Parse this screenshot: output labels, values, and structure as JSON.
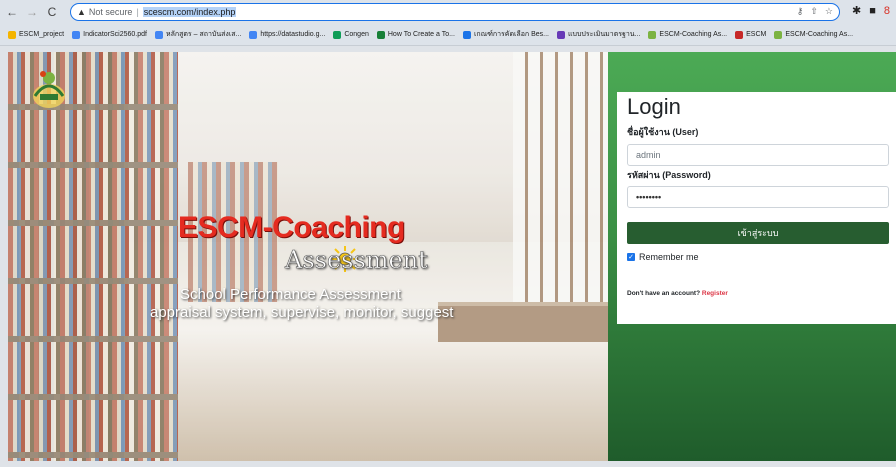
{
  "browser": {
    "security_label": "Not secure",
    "url": "scescm.com/index.php"
  },
  "bookmarks": [
    {
      "label": "ESCM_project",
      "color": "#f4b400"
    },
    {
      "label": "IndicatorSci2560.pdf",
      "color": "#4285f4"
    },
    {
      "label": "หลักสูตร – สถาบันส่งเส...",
      "color": "#4285f4"
    },
    {
      "label": "https://datastudio.g...",
      "color": "#4285f4"
    },
    {
      "label": "Congen",
      "color": "#0f9d58"
    },
    {
      "label": "How To Create a To...",
      "color": "#188038"
    },
    {
      "label": "เกณฑ์การคัดเลือก Bes...",
      "color": "#1a73e8"
    },
    {
      "label": "แบบประเมินมาตรฐาน...",
      "color": "#673ab7"
    },
    {
      "label": "ESCM-Coaching As...",
      "color": "#7cb342"
    },
    {
      "label": "ESCM",
      "color": "#c62828"
    },
    {
      "label": "ESCM-Coaching As...",
      "color": "#7cb342"
    }
  ],
  "hero": {
    "title": "ESCM-Coaching",
    "subtitle": "Assessment",
    "tagline1": "School Performance Assessment",
    "tagline2": "appraisal system, supervise, monitor, suggest"
  },
  "login": {
    "heading": "Login",
    "user_label": "ชื่อผู้ใช้งาน (User)",
    "user_value": "admin",
    "password_label": "รหัสผ่าน (Password)",
    "password_value": "••••••••",
    "submit_label": "เข้าสู่ระบบ",
    "remember_label": "Remember me",
    "account_prompt": "Don't have an account?",
    "register_label": "Register"
  }
}
